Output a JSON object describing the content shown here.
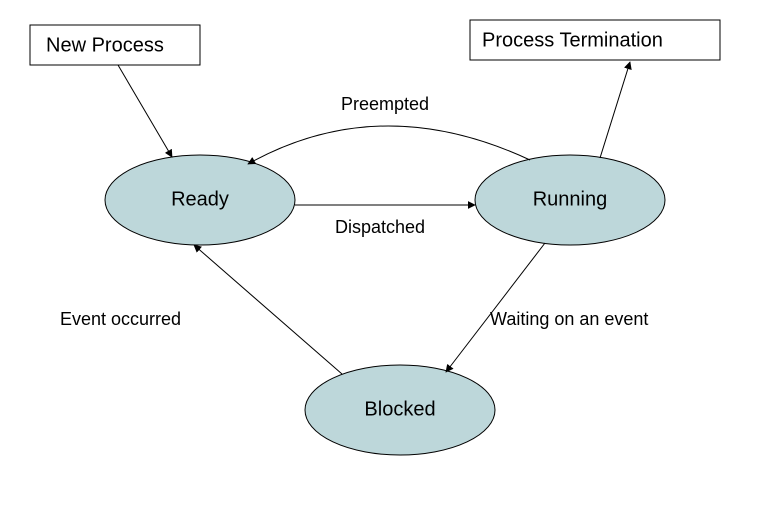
{
  "nodes": {
    "new_process": "New Process",
    "termination": "Process Termination",
    "ready": "Ready",
    "running": "Running",
    "blocked": "Blocked"
  },
  "edges": {
    "preempted": "Preempted",
    "dispatched": "Dispatched",
    "waiting": "Waiting on an event",
    "event_occurred": "Event occurred"
  }
}
